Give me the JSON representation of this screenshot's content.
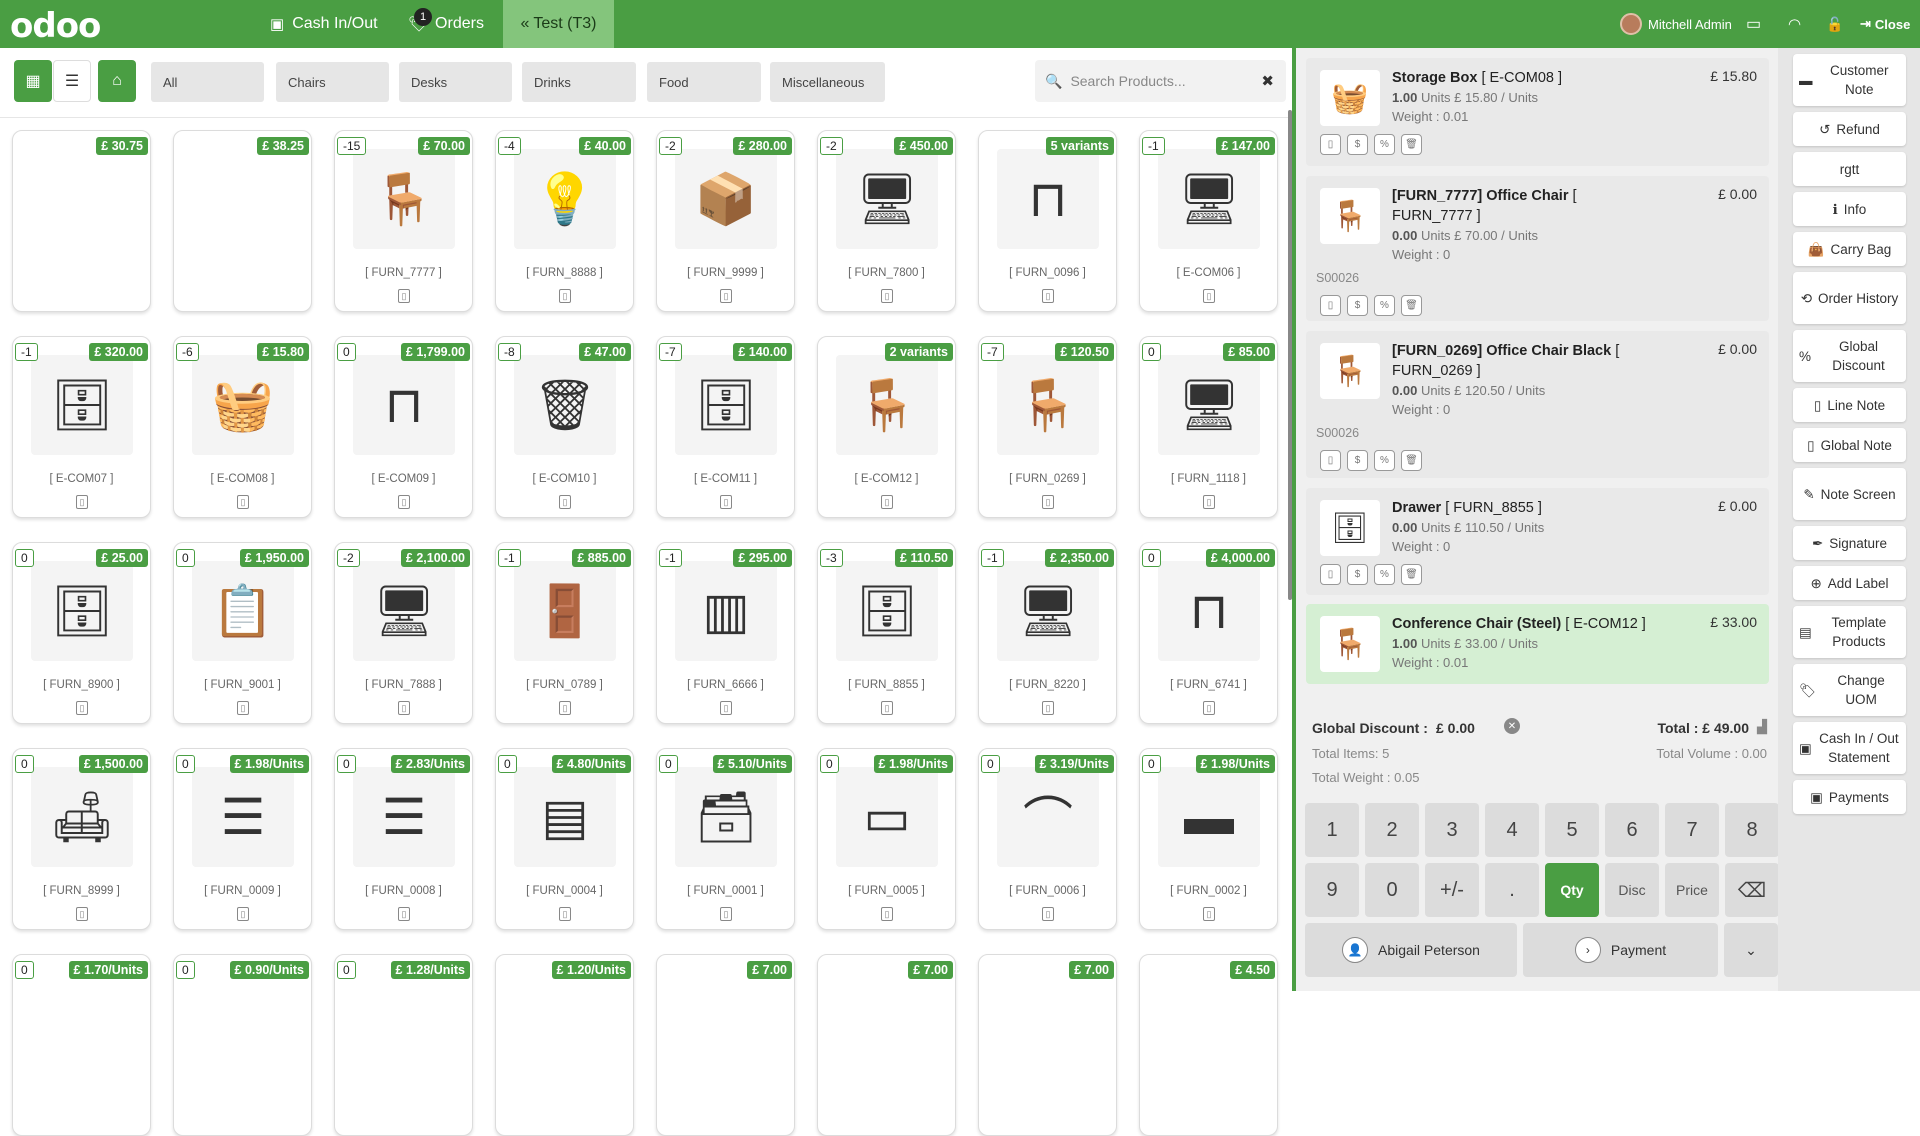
{
  "topbar": {
    "logo": "odoo",
    "cash_label": "Cash In/Out",
    "orders_label": "Orders",
    "orders_badge": "1",
    "active_tab": "Test (T3)",
    "user": "Mitchell Admin",
    "close_label": "Close"
  },
  "categories": [
    "All",
    "Chairs",
    "Desks",
    "Drinks",
    "Food",
    "Miscellaneous"
  ],
  "search": {
    "placeholder": "Search Products..."
  },
  "products": [
    {
      "price": "£ 30.75",
      "qty": "",
      "ref": "",
      "icon": ""
    },
    {
      "price": "£ 38.25",
      "qty": "",
      "ref": "",
      "icon": ""
    },
    {
      "price": "£ 70.00",
      "qty": "-15",
      "ref": "[ FURN_7777 ]",
      "icon": "chair"
    },
    {
      "price": "£ 40.00",
      "qty": "-4",
      "ref": "[ FURN_8888 ]",
      "icon": "lamp"
    },
    {
      "price": "£ 280.00",
      "qty": "-2",
      "ref": "[ FURN_9999 ]",
      "icon": "box"
    },
    {
      "price": "£ 450.00",
      "qty": "-2",
      "ref": "[ FURN_7800 ]",
      "icon": "desk"
    },
    {
      "price": "5 variants",
      "qty": "",
      "ref": "[ FURN_0096 ]",
      "icon": "table"
    },
    {
      "price": "£ 147.00",
      "qty": "-1",
      "ref": "[ E-COM06 ]",
      "icon": "desk"
    },
    {
      "price": "£ 320.00",
      "qty": "-1",
      "ref": "[ E-COM07 ]",
      "icon": "cabinet"
    },
    {
      "price": "£ 15.80",
      "qty": "-6",
      "ref": "[ E-COM08 ]",
      "icon": "basket"
    },
    {
      "price": "£ 1,799.00",
      "qty": "0",
      "ref": "[ E-COM09 ]",
      "icon": "table"
    },
    {
      "price": "£ 47.00",
      "qty": "-8",
      "ref": "[ E-COM10 ]",
      "icon": "bin"
    },
    {
      "price": "£ 140.00",
      "qty": "-7",
      "ref": "[ E-COM11 ]",
      "icon": "cabinet"
    },
    {
      "price": "2 variants",
      "qty": "",
      "ref": "[ E-COM12 ]",
      "icon": "chair"
    },
    {
      "price": "£ 120.50",
      "qty": "-7",
      "ref": "[ FURN_0269 ]",
      "icon": "chair"
    },
    {
      "price": "£ 85.00",
      "qty": "0",
      "ref": "[ FURN_1118 ]",
      "icon": "desk"
    },
    {
      "price": "£ 25.00",
      "qty": "0",
      "ref": "[ FURN_8900 ]",
      "icon": "cabinet"
    },
    {
      "price": "£ 1,950.00",
      "qty": "0",
      "ref": "[ FURN_9001 ]",
      "icon": "board"
    },
    {
      "price": "£ 2,100.00",
      "qty": "-2",
      "ref": "[ FURN_7888 ]",
      "icon": "desk"
    },
    {
      "price": "£ 885.00",
      "qty": "-1",
      "ref": "[ FURN_0789 ]",
      "icon": "booth"
    },
    {
      "price": "£ 295.00",
      "qty": "-1",
      "ref": "[ FURN_6666 ]",
      "icon": "screen"
    },
    {
      "price": "£ 110.50",
      "qty": "-3",
      "ref": "[ FURN_8855 ]",
      "icon": "cabinet"
    },
    {
      "price": "£ 2,350.00",
      "qty": "-1",
      "ref": "[ FURN_8220 ]",
      "icon": "desk"
    },
    {
      "price": "£ 4,000.00",
      "qty": "0",
      "ref": "[ FURN_6741 ]",
      "icon": "table"
    },
    {
      "price": "£ 1,500.00",
      "qty": "0",
      "ref": "[ FURN_8999 ]",
      "icon": "sofa"
    },
    {
      "price": "£ 1.98/Units",
      "qty": "0",
      "ref": "[ FURN_0009 ]",
      "icon": "shelf"
    },
    {
      "price": "£ 2.83/Units",
      "qty": "0",
      "ref": "[ FURN_0008 ]",
      "icon": "shelf"
    },
    {
      "price": "£ 4.80/Units",
      "qty": "0",
      "ref": "[ FURN_0004 ]",
      "icon": "drawers"
    },
    {
      "price": "£ 5.10/Units",
      "qty": "0",
      "ref": "[ FURN_0001 ]",
      "icon": "organizer"
    },
    {
      "price": "£ 1.98/Units",
      "qty": "0",
      "ref": "[ FURN_0005 ]",
      "icon": "panel"
    },
    {
      "price": "£ 3.19/Units",
      "qty": "0",
      "ref": "[ FURN_0006 ]",
      "icon": "stand"
    },
    {
      "price": "£ 1.98/Units",
      "qty": "0",
      "ref": "[ FURN_0002 ]",
      "icon": "tray"
    },
    {
      "price": "£ 1.70/Units",
      "qty": "0",
      "ref": "",
      "icon": ""
    },
    {
      "price": "£ 0.90/Units",
      "qty": "0",
      "ref": "",
      "icon": ""
    },
    {
      "price": "£ 1.28/Units",
      "qty": "0",
      "ref": "",
      "icon": ""
    },
    {
      "price": "£ 1.20/Units",
      "qty": "",
      "ref": "",
      "icon": ""
    },
    {
      "price": "£ 7.00",
      "qty": "",
      "ref": "",
      "icon": ""
    },
    {
      "price": "£ 7.00",
      "qty": "",
      "ref": "",
      "icon": ""
    },
    {
      "price": "£ 7.00",
      "qty": "",
      "ref": "",
      "icon": ""
    },
    {
      "price": "£ 4.50",
      "qty": "",
      "ref": "",
      "icon": ""
    }
  ],
  "order_lines": [
    {
      "name": "Storage Box",
      "code": "[ E-COM08 ]",
      "price": "£ 15.80",
      "qty": "1.00",
      "unit": "Units £ 15.80 / Units",
      "weight": "Weight : 0.01",
      "so": "",
      "icon": "basket"
    },
    {
      "name": "[FURN_7777] Office Chair",
      "code": "[ FURN_7777 ]",
      "price": "£ 0.00",
      "qty": "0.00",
      "unit": "Units £ 70.00 / Units",
      "weight": "Weight : 0",
      "so": "S00026",
      "icon": "chair"
    },
    {
      "name": "[FURN_0269] Office Chair Black",
      "code": "[ FURN_0269 ]",
      "price": "£ 0.00",
      "qty": "0.00",
      "unit": "Units £ 120.50 / Units",
      "weight": "Weight : 0",
      "so": "S00026",
      "icon": "chair"
    },
    {
      "name": "Drawer",
      "code": "[ FURN_8855 ]",
      "price": "£ 0.00",
      "qty": "0.00",
      "unit": "Units £ 110.50 / Units",
      "weight": "Weight : 0",
      "so": "",
      "icon": "cabinet"
    },
    {
      "name": "Conference Chair (Steel)",
      "code": "[ E-COM12 ]",
      "price": "£ 33.00",
      "qty": "1.00",
      "unit": "Units £ 33.00 / Units",
      "weight": "Weight : 0.01",
      "so": "",
      "icon": "chair"
    }
  ],
  "summary": {
    "global_discount_label": "Global Discount :",
    "global_discount_value": "£ 0.00",
    "total": "Total : £ 49.00",
    "total_items": "Total Items: 5",
    "total_volume": "Total Volume : 0.00",
    "total_weight": "Total Weight : 0.05"
  },
  "numpad": {
    "row1": [
      "1",
      "2",
      "3",
      "4",
      "5",
      "6",
      "7",
      "8"
    ],
    "row2": [
      "9",
      "0",
      "+/-",
      ".",
      "Qty",
      "Disc",
      "Price"
    ],
    "customer": "Abigail Peterson",
    "payment": "Payment"
  },
  "controls": [
    "Customer Note",
    "Refund",
    "rgtt",
    "Info",
    "Carry Bag",
    "Order History",
    "Global Discount",
    "Line Note",
    "Global Note",
    "Note Screen",
    "Signature",
    "Add Label",
    "Template Products",
    "Change UOM",
    "Cash In / Out Statement",
    "Payments"
  ],
  "colors": {
    "brand": "#4a9e43",
    "active_tab": "#84c57c",
    "selected_line": "#d5efd3"
  }
}
